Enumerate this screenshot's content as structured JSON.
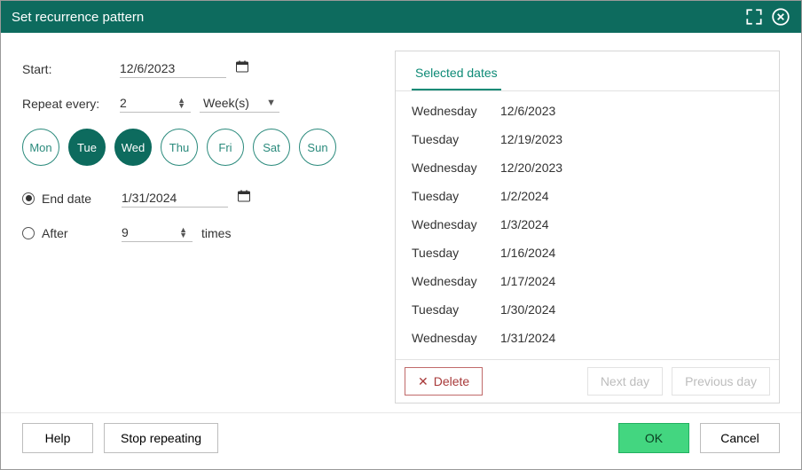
{
  "titlebar": {
    "title": "Set recurrence pattern"
  },
  "start": {
    "label": "Start:",
    "value": "12/6/2023"
  },
  "repeat": {
    "label": "Repeat every:",
    "count": "2",
    "unit": "Week(s)"
  },
  "days": [
    {
      "abbr": "Mon",
      "selected": false
    },
    {
      "abbr": "Tue",
      "selected": true
    },
    {
      "abbr": "Wed",
      "selected": true
    },
    {
      "abbr": "Thu",
      "selected": false
    },
    {
      "abbr": "Fri",
      "selected": false
    },
    {
      "abbr": "Sat",
      "selected": false
    },
    {
      "abbr": "Sun",
      "selected": false
    }
  ],
  "end": {
    "mode": "end_date",
    "date_label": "End date",
    "date_value": "1/31/2024",
    "after_label": "After",
    "after_count": "9",
    "after_unit": "times"
  },
  "selected_tab": "Selected dates",
  "dates": [
    {
      "dow": "Wednesday",
      "date": "12/6/2023"
    },
    {
      "dow": "Tuesday",
      "date": "12/19/2023"
    },
    {
      "dow": "Wednesday",
      "date": "12/20/2023"
    },
    {
      "dow": "Tuesday",
      "date": "1/2/2024"
    },
    {
      "dow": "Wednesday",
      "date": "1/3/2024"
    },
    {
      "dow": "Tuesday",
      "date": "1/16/2024"
    },
    {
      "dow": "Wednesday",
      "date": "1/17/2024"
    },
    {
      "dow": "Tuesday",
      "date": "1/30/2024"
    },
    {
      "dow": "Wednesday",
      "date": "1/31/2024"
    }
  ],
  "list_actions": {
    "delete": "Delete",
    "next": "Next day",
    "prev": "Previous day"
  },
  "footer": {
    "help": "Help",
    "stop": "Stop repeating",
    "ok": "OK",
    "cancel": "Cancel"
  }
}
